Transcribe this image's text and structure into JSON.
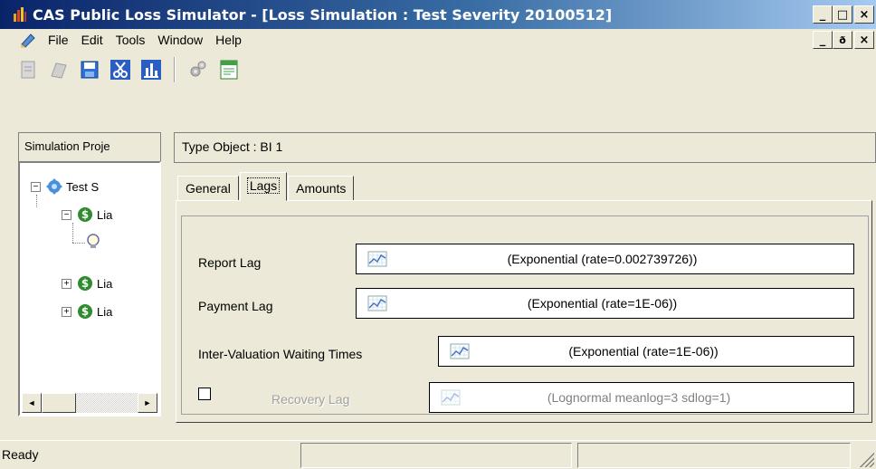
{
  "window": {
    "title": "CAS Public Loss Simulator - [Loss Simulation : Test Severity 20100512]",
    "controls": {
      "minimize": "_",
      "maximize": "□",
      "close": "×",
      "restore": "ð"
    }
  },
  "menu": {
    "items": [
      "File",
      "Edit",
      "Tools",
      "Window",
      "Help"
    ]
  },
  "toolbar": {
    "icons": [
      "new-icon",
      "open-icon",
      "save-icon",
      "cut-icon",
      "chart-icon",
      "settings-gears-icon",
      "report-icon"
    ]
  },
  "left_pane": {
    "tab_label": "Simulation Proje",
    "tree": {
      "root": {
        "expander": "−",
        "label": "Test S"
      },
      "nodes": [
        {
          "expander": "−",
          "label": "Lia"
        },
        {
          "label": ""
        },
        {
          "expander": "+",
          "label": "Lia"
        },
        {
          "expander": "+",
          "label": "Lia"
        }
      ]
    },
    "scrollbar": {
      "left_arrow": "◄",
      "right_arrow": "►"
    }
  },
  "right_pane": {
    "type_object": "Type Object : BI 1",
    "tabs": [
      "General",
      "Lags",
      "Amounts"
    ],
    "active_tab": "Lags",
    "fields": {
      "report_lag": {
        "label": "Report Lag",
        "value": "(Exponential (rate=0.002739726))"
      },
      "payment_lag": {
        "label": "Payment Lag",
        "value": "(Exponential (rate=1E-06))"
      },
      "inter_valuation": {
        "label": "Inter-Valuation Waiting Times",
        "value": "(Exponential (rate=1E-06))"
      },
      "recovery_lag": {
        "label": "Recovery Lag",
        "value": "(Lognormal meanlog=3  sdlog=1)",
        "checked": false
      }
    }
  },
  "status_bar": {
    "text": "Ready"
  },
  "colors": {
    "title_start": "#0a246a",
    "title_end": "#a6caf0",
    "chrome": "#ece9d8"
  }
}
